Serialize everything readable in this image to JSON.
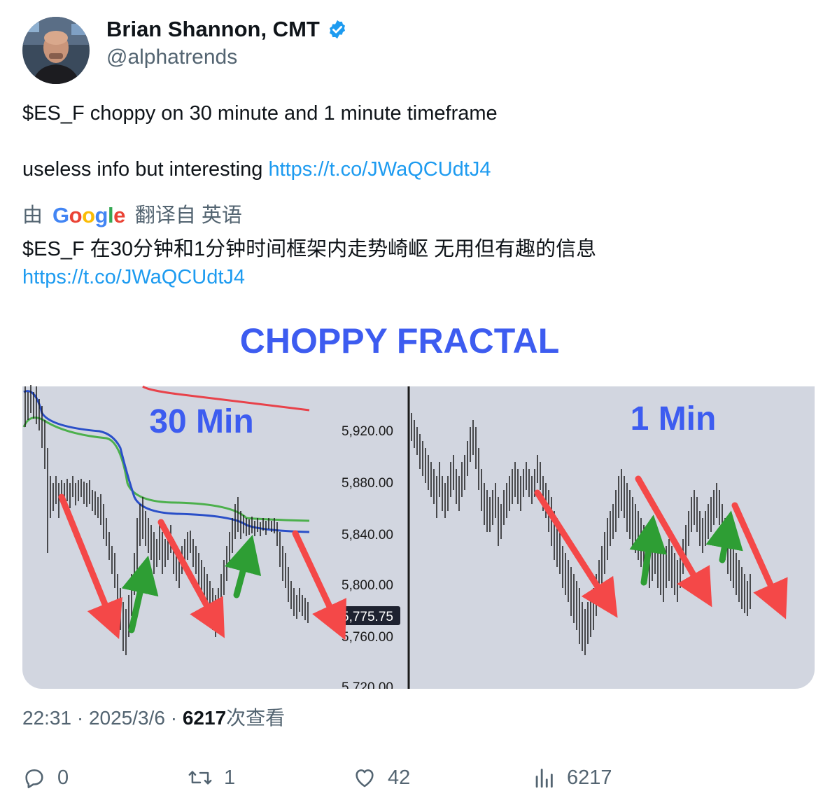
{
  "author": {
    "name": "Brian Shannon, CMT",
    "handle": "@alphatrends",
    "verified_icon": "verified-badge-icon"
  },
  "tweet": {
    "line1": "$ES_F choppy on 30 minute and 1 minute timeframe",
    "line2_text": "useless info but interesting ",
    "line2_link": "https://t.co/JWaQCUdtJ4"
  },
  "translation": {
    "by_label": "由",
    "google_label": "Google",
    "from_label": "翻译自 英语",
    "text": "$ES_F 在30分钟和1分钟时间框架内走势崎岖 无用但有趣的信息",
    "link": "https://t.co/JWaQCUdtJ4"
  },
  "media": {
    "banner_title": "CHOPPY FRACTAL",
    "left_panel_label": "30 Min",
    "right_panel_label": "1 Min",
    "price_ticks": [
      "5,920.00",
      "5,880.00",
      "5,840.00",
      "5,800.00",
      "5,760.00",
      "5,720.00"
    ],
    "last_price_tag": "5,775.75"
  },
  "meta": {
    "time": "22:31",
    "date": "2025/3/6",
    "views_count": "6217",
    "views_label": "次查看"
  },
  "actions": {
    "reply_count": "0",
    "retweet_count": "1",
    "like_count": "42",
    "view_count": "6217"
  },
  "colors": {
    "link": "#1d9bf0",
    "muted": "#536471",
    "banner_blue": "#3d5cf0",
    "arrow_red": "#f44848",
    "arrow_green": "#2e9e34"
  }
}
